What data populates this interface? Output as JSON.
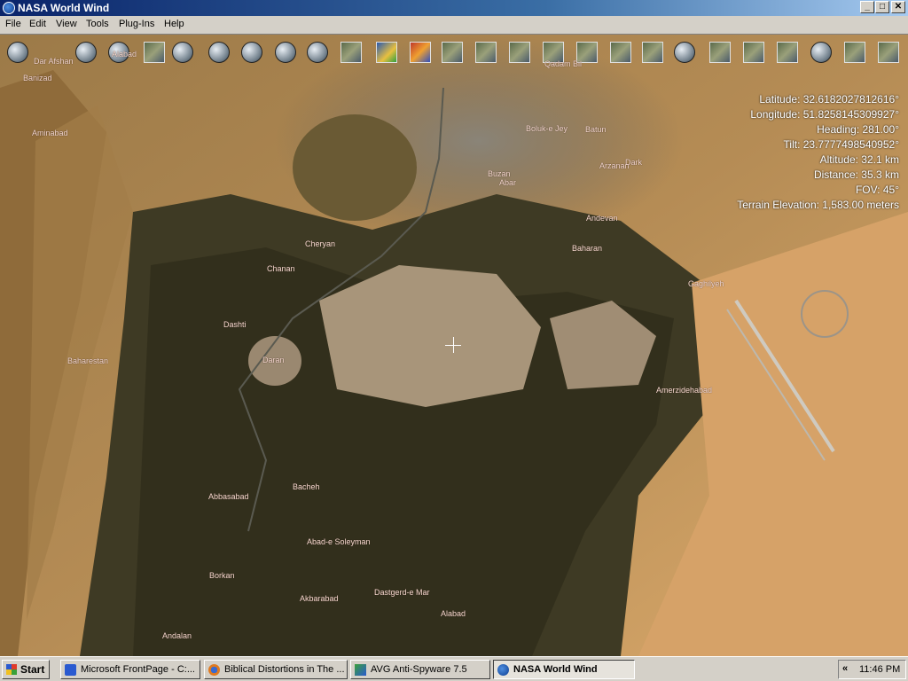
{
  "window": {
    "title": "NASA World Wind",
    "min_label": "_",
    "max_label": "□",
    "close_label": "✕"
  },
  "menu": [
    "File",
    "Edit",
    "View",
    "Tools",
    "Plug-Ins",
    "Help"
  ],
  "toolbar_icons": [
    "layers-icon",
    "globe-grid-icon",
    "globe-icon",
    "camera-icon",
    "compass-icon",
    "globe-icon",
    "globe-icon",
    "globe-icon",
    "globe-icon",
    "wms-tile-icon",
    "red-tile-icon",
    "satellite-tile-icon",
    "satellite-tile-icon",
    "satellite-tile-icon",
    "satellite-tile-icon",
    "satellite-tile-icon",
    "satellite-tile-icon",
    "satellite-tile-icon",
    "satellite-tile-icon",
    "globe-icon",
    "satellite-tile-icon",
    "satellite-tile-icon",
    "satellite-tile-icon",
    "globe-icon",
    "satellite-tile-icon",
    "satellite-tile-icon"
  ],
  "hud": {
    "latitude": "Latitude: 32.6182027812616°",
    "longitude": "Longitude: 51.8258145309927°",
    "heading": "Heading: 281.00°",
    "tilt": "Tilt: 23.7777498540952°",
    "altitude": "Altitude: 32.1 km",
    "distance": "Distance: 35.3 km",
    "fov": "FOV: 45°",
    "terrain_elevation": "Terrain Elevation: 1,583.00 meters"
  },
  "places": {
    "dar_afshan": "Dar Afshan",
    "banizad": "Banizad",
    "alabad_top": "Alabad",
    "qadam_bil": "Qadam Bil",
    "aminabad": "Aminabad",
    "boluk_e_jey": "Boluk-e Jey",
    "batun": "Batun",
    "arzanan": "Arzanan",
    "dark": "Dark",
    "buzan": "Buzan",
    "abar": "Abar",
    "andevan": "Andevan",
    "cheryan": "Cheryan",
    "baharan": "Baharan",
    "chanan": "Chanan",
    "gaghilyeh": "Gaghilyeh",
    "dashti": "Dashti",
    "baharestan": "Baharestan",
    "daran": "Daran",
    "amerzidehabad": "Amerzidehabad",
    "abbasabad": "Abbasabad",
    "bacheh": "Bacheh",
    "abad_e_soleyman": "Abad-e Soleyman",
    "borkan": "Borkan",
    "akbarabad": "Akbarabad",
    "dastgerd_e_mar": "Dastgerd-e Mar",
    "alabad_bottom": "Alabad",
    "andalan": "Andalan"
  },
  "taskbar": {
    "start": "Start",
    "tasks": [
      {
        "label": "Microsoft FrontPage - C:...",
        "icon": "frontpage-icon"
      },
      {
        "label": "Biblical Distortions in The ...",
        "icon": "firefox-icon"
      },
      {
        "label": "AVG Anti-Spyware 7.5",
        "icon": "avg-icon"
      },
      {
        "label": "NASA World Wind",
        "icon": "nasa-icon"
      }
    ],
    "tray_chevron": "«",
    "clock": "11:46 PM"
  }
}
